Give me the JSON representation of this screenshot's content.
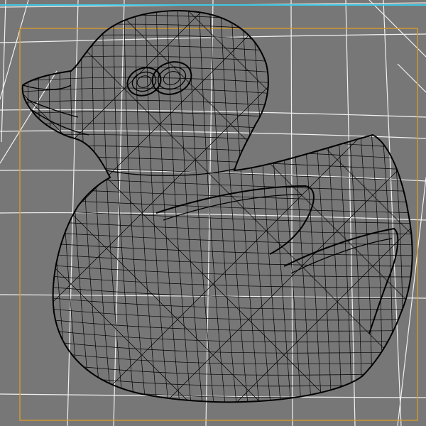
{
  "viewport": {
    "view": "perspective",
    "background_color": "#777777",
    "grid_color": "#ffffff",
    "top_edge_color": "#40c8e0",
    "safe_frame_color": "#d89a2a",
    "wire_color": "#000000",
    "shading": "wireframe",
    "model_icon": "rubber-duck-icon"
  }
}
